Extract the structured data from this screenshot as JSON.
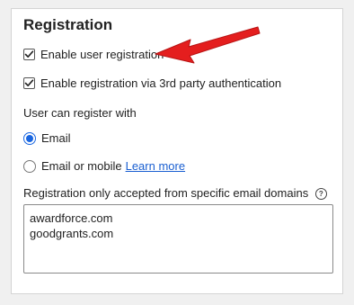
{
  "panel": {
    "title": "Registration"
  },
  "options": {
    "enable_user_registration": {
      "label": "Enable user registration",
      "checked": true
    },
    "enable_third_party": {
      "label": "Enable registration via 3rd party authentication",
      "checked": true
    }
  },
  "register_with": {
    "label": "User can register with",
    "choices": [
      {
        "label": "Email",
        "selected": true
      },
      {
        "label": "Email or mobile",
        "selected": false,
        "link": "Learn more"
      }
    ]
  },
  "domains": {
    "label": "Registration only accepted from specific email domains",
    "help_icon": "question-circle-icon",
    "value": "awardforce.com\ngoodgrants.com"
  },
  "annotation": {
    "icon": "red-arrow-icon",
    "color": "#e41e1e"
  },
  "colors": {
    "accent": "#1a66e0",
    "link": "#1a5fd1"
  }
}
